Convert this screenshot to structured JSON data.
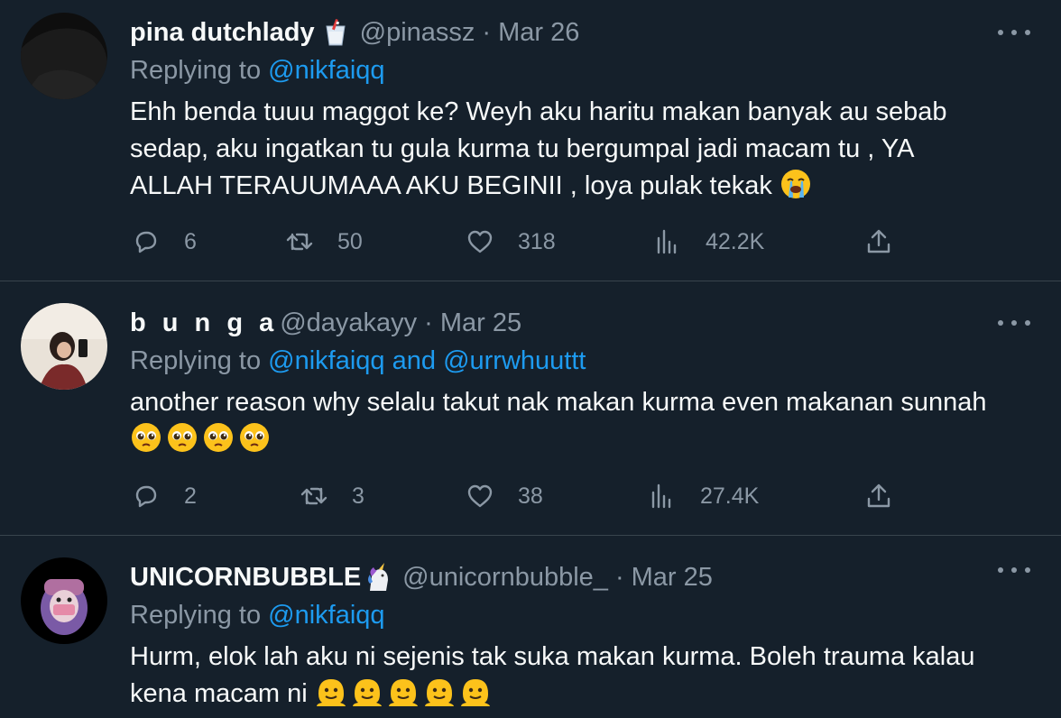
{
  "tweets": [
    {
      "name": "pina dutchlady",
      "handle": "@pinassz",
      "date": "Mar 26",
      "replying_prefix": "Replying to",
      "replying_to": "@nikfaiqq",
      "replying_and": "",
      "replying_to_2": "",
      "text_lines": [
        "Ehh benda tuuu maggot ke? Weyh aku haritu makan banyak au sebab",
        "sedap, aku ingatkan tu gula kurma tu bergumpal jadi macam tu , YA",
        "ALLAH TERAUUMAAA AKU BEGINII , loya pulak tekak"
      ],
      "emoji_icon": "loudly-crying-face-icon",
      "badge_icon": "cup-with-straw-icon",
      "replies": "6",
      "retweets": "50",
      "likes": "318",
      "views": "42.2K"
    },
    {
      "name": "b u n g a",
      "handle": "@dayakayy",
      "date": "Mar 25",
      "replying_prefix": "Replying to",
      "replying_to": "@nikfaiqq",
      "replying_and": "and",
      "replying_to_2": "@urrwhuuttt",
      "text_lines": [
        "another reason why selalu takut nak makan kurma even makanan sunnah"
      ],
      "emoji_icon": "pleading-face-icon",
      "emoji_count": 4,
      "replies": "2",
      "retweets": "3",
      "likes": "38",
      "views": "27.4K"
    },
    {
      "name": "UNICORNBUBBLE",
      "handle": "@unicornbubble_",
      "date": "Mar 25",
      "replying_prefix": "Replying to",
      "replying_to": "@nikfaiqq",
      "replying_and": "",
      "replying_to_2": "",
      "text_lines": [
        "Hurm, elok lah aku ni sejenis tak suka makan kurma. Boleh trauma kalau",
        "kena macam ni"
      ],
      "emoji_icon": "melting-face-icon",
      "emoji_count": 5,
      "badge_icon": "unicorn-icon"
    }
  ],
  "separator": "·",
  "colors": {
    "background": "#15202b",
    "text": "#f7f9f9",
    "secondary": "#8b98a5",
    "link": "#1d9bf0",
    "divider": "#38444d"
  }
}
